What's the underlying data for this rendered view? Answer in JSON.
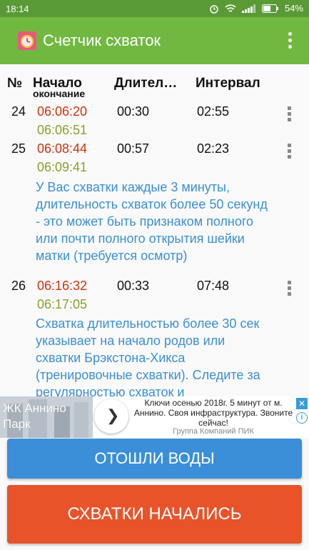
{
  "status_bar": {
    "time": "18:14",
    "battery": "54%"
  },
  "app_bar": {
    "title": "Счетчик схваток"
  },
  "table": {
    "headers": {
      "num": "№",
      "start": "Начало",
      "end": "окончание",
      "duration": "Длител…",
      "interval": "Интервал"
    },
    "rows": [
      {
        "num": "24",
        "start": "06:06:20",
        "end": "06:06:51",
        "duration": "00:30",
        "interval": "02:55"
      },
      {
        "num": "25",
        "start": "06:08:44",
        "end": "06:09:41",
        "duration": "00:57",
        "interval": "02:23"
      },
      {
        "num": "26",
        "start": "06:16:32",
        "end": "06:17:05",
        "duration": "00:33",
        "interval": "07:48"
      }
    ],
    "notes": [
      "У Вас схватки каждые 3 минуты, длительность схваток более 50 секунд - это может быть признаком полного или почти полного открытия шейки матки (требуется осмотр)",
      "Схватка длительностью более 30 сек указывает на начало родов или схватки Брэкстона-Хикса (тренировочные схватки). Следите за регулярностью схваток и длительностью"
    ]
  },
  "ad": {
    "brand": "ЖК Аннино Парк",
    "text": "Ключи осенью 2018г. 5 минут от м. Аннино. Своя инфраструктура. Звоните сейчас!",
    "company": "Группа Компаний ПИК"
  },
  "buttons": {
    "water": "ОТОШЛИ ВОДЫ",
    "start": "СХВАТКИ НАЧАЛИСЬ"
  },
  "colors": {
    "status_bar": "#5a9a36",
    "app_bar": "#71b841",
    "start_time": "#cc3311",
    "end_time": "#8aa02c",
    "note_text": "#3b8fcf",
    "button_blue": "#3a8fd8",
    "button_orange": "#e8532a"
  }
}
